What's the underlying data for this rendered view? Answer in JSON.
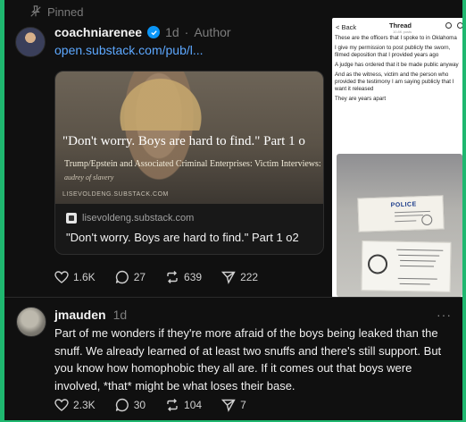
{
  "pinned_label": "Pinned",
  "post1": {
    "username": "coachniarenee",
    "time": "1d",
    "role_sep": "·",
    "role": "Author",
    "link_text": "open.substack.com/pub/l...",
    "card": {
      "image_title": "\"Don't worry. Boys are hard to find.\" Part 1 o",
      "image_subtitle": "Trump/Epstein and Associated Criminal Enterprises: Victim Interviews: SR",
      "image_byline": "audrey of slavery",
      "image_domain": "LISEVOLDENG.SUBSTACK.COM",
      "domain": "lisevoldeng.substack.com",
      "title": "\"Don't worry. Boys are hard to find.\" Part 1 o2"
    },
    "screenshot": {
      "back_label": "< Back",
      "title": "Thread",
      "subtitle": "10.8K posts",
      "paragraphs": [
        "These are the officers that I spoke to in Oklahoma",
        "I give my permission to post publicly the sworn, filmed deposition that I provided years ago",
        "A judge has ordered that it be made public anyway",
        "And as the witness, victim and the person who provided the testimony I am saying publicly that I want it released",
        "They are years apart"
      ],
      "card_header": "POLICE"
    },
    "counts": {
      "likes": "1.6K",
      "replies": "27",
      "reposts": "639",
      "shares": "222"
    }
  },
  "post2": {
    "username": "jmauden",
    "time": "1d",
    "more": "···",
    "text": "Part of me wonders if they're more afraid of the boys being leaked than the snuff. We already learned of at least two snuffs and there's still support. But you know how homophobic they all are. If it comes out that boys were involved, *that* might be what loses their base.",
    "counts": {
      "likes": "2.3K",
      "replies": "30",
      "reposts": "104",
      "shares": "7"
    }
  },
  "colors": {
    "background": "#101010",
    "border": "#1fb870",
    "link": "#5da8ff",
    "verified": "#0a95f6"
  },
  "icons": [
    "pin-icon",
    "verified-icon",
    "heart-icon",
    "comment-icon",
    "repost-icon",
    "share-icon",
    "more-icon"
  ]
}
